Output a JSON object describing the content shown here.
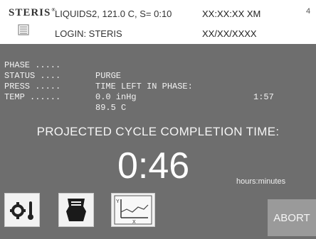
{
  "header": {
    "brand": "STERIS",
    "brand_mark": "®",
    "cycle_info": "LIQUIDS2, 121.0 C, S= 0:10",
    "login": "LOGIN: STERIS",
    "time": "XX:XX:XX XM",
    "date": "XX/XX/XXXX",
    "screen_number": "4"
  },
  "status": {
    "phase_label": "PHASE .....",
    "phase_value": "PURGE",
    "status_label": "STATUS ....",
    "status_value": "TIME LEFT IN PHASE:",
    "status_time": "1:57",
    "press_label": "PRESS .....",
    "press_value": "0.0 inHg",
    "temp_label": "TEMP ......",
    "temp_value": "89.5 C"
  },
  "projection": {
    "label": "PROJECTED CYCLE COMPLETION TIME:",
    "time": "0:46",
    "units": "hours:minutes"
  },
  "buttons": {
    "abort_label": "ABORT",
    "icons": [
      "sensor-thermometer-icon",
      "print-icon",
      "graph-icon"
    ]
  }
}
